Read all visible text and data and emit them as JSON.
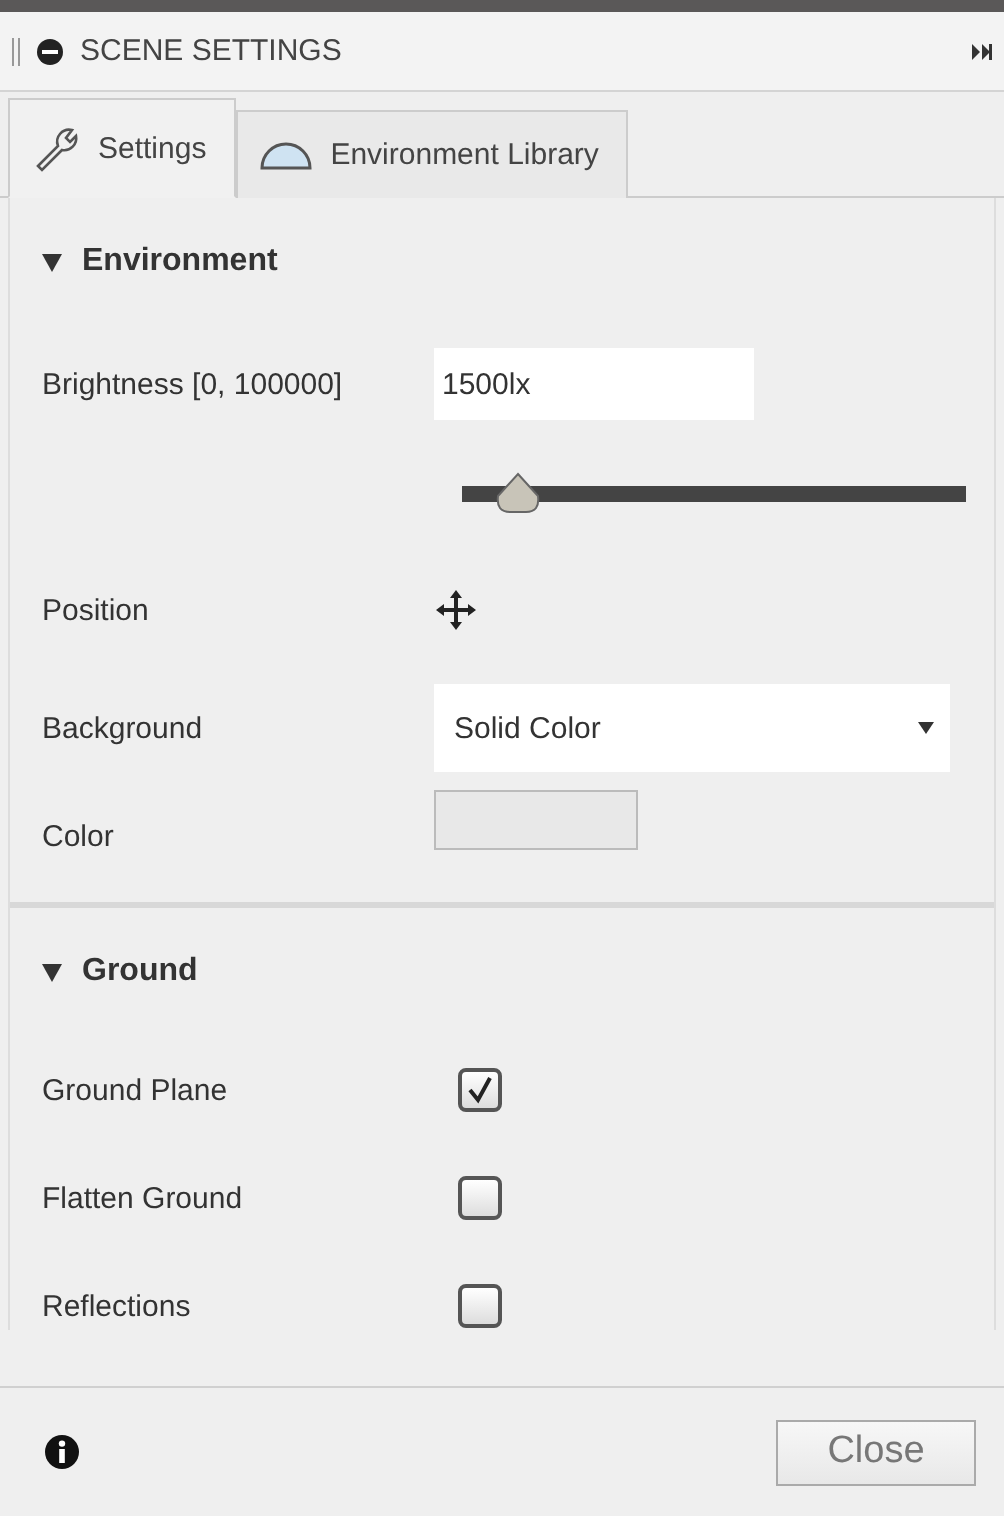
{
  "panel": {
    "title": "SCENE SETTINGS"
  },
  "tabs": [
    {
      "label": "Settings",
      "selected": true
    },
    {
      "label": "Environment Library",
      "selected": false
    }
  ],
  "sections": [
    {
      "title": "Environment",
      "expanded": true,
      "rows": [
        {
          "kind": "field",
          "label": "Brightness [0, 100000]",
          "value": "1500lx"
        },
        {
          "kind": "slider",
          "level": 0.07
        },
        {
          "kind": "move",
          "label": "Position"
        },
        {
          "kind": "dropdown",
          "label": "Background",
          "value": "Solid Color"
        },
        {
          "kind": "swatch",
          "label": "Color"
        }
      ]
    },
    {
      "title": "Ground",
      "expanded": true,
      "rows": [
        {
          "kind": "checkbox",
          "label": "Ground Plane",
          "checked": true
        },
        {
          "kind": "checkbox",
          "label": "Flatten Ground",
          "checked": false
        },
        {
          "kind": "checkbox",
          "label": "Reflections",
          "checked": false
        }
      ]
    }
  ],
  "footer": {
    "button": "Close"
  }
}
